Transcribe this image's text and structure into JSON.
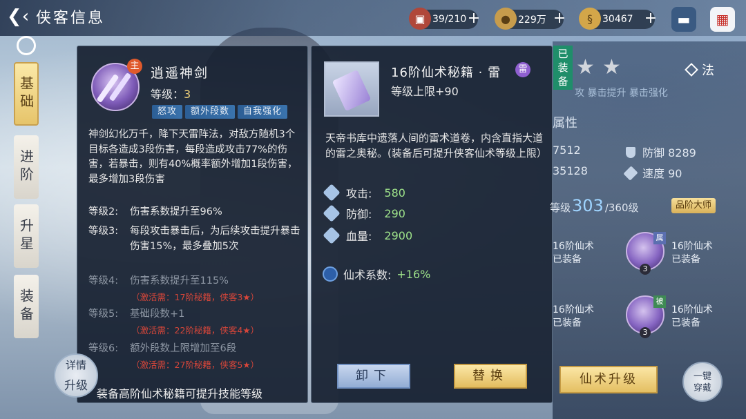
{
  "header": {
    "title": "侠客信息",
    "resources": [
      {
        "icon": "chest-icon",
        "value": "39/210"
      },
      {
        "icon": "coin-icon",
        "value": "229万"
      },
      {
        "icon": "dragon-icon",
        "value": "30467"
      }
    ]
  },
  "tabs": [
    {
      "label": "基础",
      "active": true
    },
    {
      "label": "进阶",
      "active": false
    },
    {
      "label": "升星",
      "active": false
    },
    {
      "label": "装备",
      "active": false
    }
  ],
  "skill": {
    "main_badge": "主",
    "name": "逍遥神剑",
    "level_label": "等级：",
    "level_value": "3",
    "tags": [
      "怒攻",
      "额外段数",
      "自我强化"
    ],
    "description": "神剑幻化万千，降下天雷阵法，对敌方随机3个目标各造成3段伤害，每段造成攻击77%的伤害，若暴击，则有40%概率额外增加1段伤害，最多增加3段伤害",
    "levels": [
      {
        "label": "等级2:",
        "text": "伤害系数提升至96%",
        "active": true
      },
      {
        "label": "等级3:",
        "text": "每段攻击暴击后，为后续攻击提升暴击伤害15%，最多叠加5次",
        "active": true
      },
      {
        "label": "等级4:",
        "text": "伤害系数提升至115%",
        "active": false,
        "requirement": "（激活需：17阶秘籍，侠客3★）"
      },
      {
        "label": "等级5:",
        "text": "基础段数+1",
        "active": false,
        "requirement": "（激活需：22阶秘籍，侠客4★）"
      },
      {
        "label": "等级6:",
        "text": "额外段数上限增加至6段",
        "active": false,
        "requirement": "（激活需：27阶秘籍，侠客5★）"
      }
    ],
    "footer": "装备高阶仙术秘籍可提升技能等级",
    "detail_btn_line1": "详情",
    "detail_btn_line2": "升级"
  },
  "book": {
    "name": "16阶仙术秘籍 · 雷",
    "type_badge": "雷",
    "level_cap": "等级上限+90",
    "description": "天帝书库中遗落人间的雷术道卷，内含直指大道的雷之奥秘。(装备后可提升侠客仙术等级上限）",
    "stats": [
      {
        "icon": "attack-icon",
        "label": "攻击:",
        "value": "580"
      },
      {
        "icon": "defense-icon",
        "label": "防御:",
        "value": "290"
      },
      {
        "icon": "hp-icon",
        "label": "血量:",
        "value": "2900"
      }
    ],
    "coef_label": "仙术系数:",
    "coef_value": "+16%",
    "unequip_label": "卸下",
    "replace_label": "替换"
  },
  "right": {
    "equipped_badge": "已装备",
    "stars": [
      "★",
      "★"
    ],
    "class_label": "法",
    "crit_line": "攻 暴击提升 暴击强化",
    "attr_title": "属性",
    "attrs": [
      {
        "label": "",
        "value": "7512"
      },
      {
        "label": "防御",
        "value": "8289"
      },
      {
        "label": "",
        "value": "35128"
      },
      {
        "label": "速度",
        "value": "90"
      }
    ],
    "xianshu_prefix": "等级",
    "xianshu_level": "303",
    "xianshu_max": "/360级",
    "grade_badge": "品阶大师",
    "slots": [
      {
        "tag": "",
        "level": "",
        "text1": "16阶仙术",
        "text2": "已装备"
      },
      {
        "tag": "属",
        "level": "3",
        "text1": "16阶仙术",
        "text2": "已装备"
      },
      {
        "tag": "",
        "level": "",
        "text1": "16阶仙术",
        "text2": "已装备"
      },
      {
        "tag": "被",
        "level": "3",
        "text1": "16阶仙术",
        "text2": "已装备"
      }
    ],
    "upgrade_label": "仙术升级",
    "onekey_line1": "一键",
    "onekey_line2": "穿戴"
  },
  "colors": {
    "accent_gold": "#e3bd5f",
    "tag_blue": "#3a73ad",
    "value_green": "#9ee28a",
    "requirement_red": "#d7463a",
    "equipped_green": "#1f8e6a"
  }
}
